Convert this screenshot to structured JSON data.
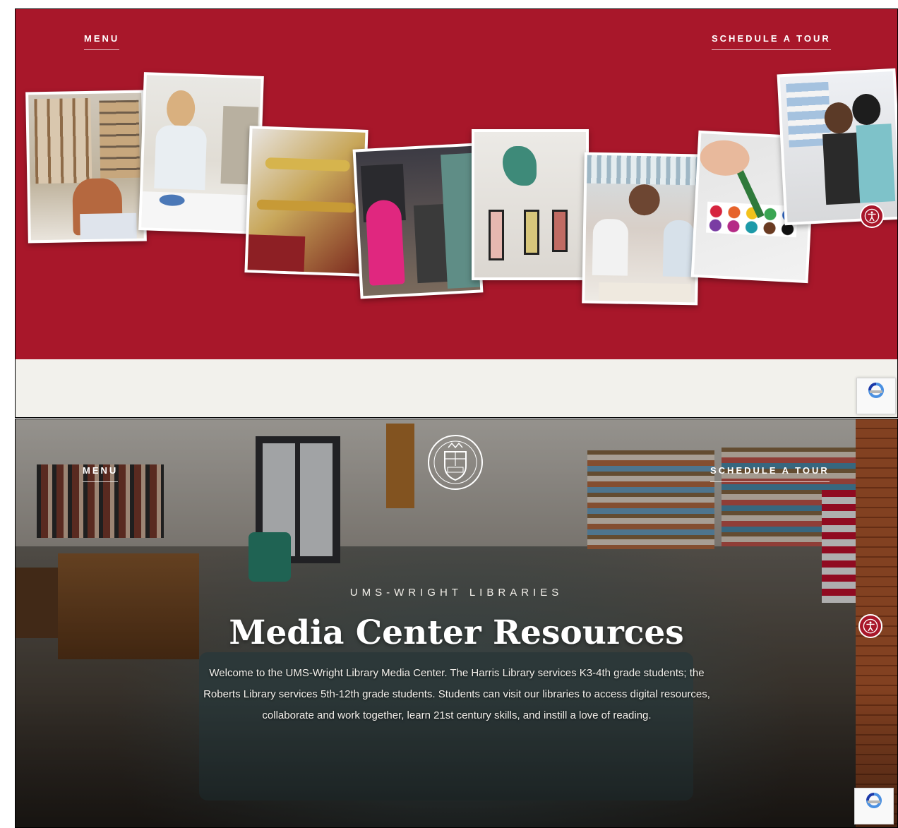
{
  "top_panel": {
    "nav": {
      "menu_label": "MENU",
      "tour_label": "SCHEDULE A TOUR"
    },
    "accessibility_icon": "accessibility-icon",
    "recaptcha_icon": "recaptcha-icon",
    "colors": {
      "hero_red": "#a8172a",
      "cream": "#f2f1ec"
    }
  },
  "bottom_panel": {
    "nav": {
      "menu_label": "MENU",
      "tour_label": "SCHEDULE A TOUR"
    },
    "eyebrow": "UMS-WRIGHT LIBRARIES",
    "title": "Media Center Resources",
    "intro_lines": [
      "Welcome to the UMS-Wright Library Media Center. The Harris Library services K3-4th grade students; the",
      "Roberts Library services 5th-12th grade students. Students can visit our libraries to access digital resources,",
      "collaborate and work together, learn 21st century skills, and instill a love of reading."
    ],
    "crest_icon": "school-crest-icon",
    "accessibility_icon": "accessibility-icon",
    "recaptcha_icon": "recaptcha-icon"
  }
}
